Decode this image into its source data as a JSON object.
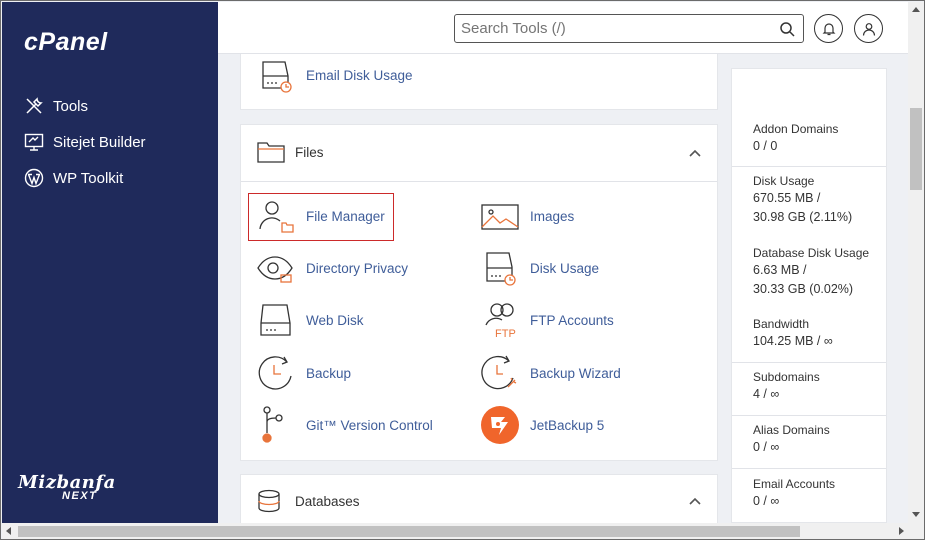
{
  "brand": {
    "logo": "cPanel",
    "footer_line1": "Mizbanfa",
    "footer_line2": "NEXT"
  },
  "sidebar": {
    "items": [
      {
        "label": "Tools",
        "icon": "tools-icon"
      },
      {
        "label": "Sitejet Builder",
        "icon": "sitejet-icon"
      },
      {
        "label": "WP Toolkit",
        "icon": "wordpress-icon"
      }
    ]
  },
  "header": {
    "search_placeholder": "Search Tools (/)",
    "notifications_icon": "bell-icon",
    "user_icon": "user-icon"
  },
  "top_panel": {
    "tool": "Email Disk Usage"
  },
  "files": {
    "title": "Files",
    "tools": [
      {
        "label": "File Manager",
        "icon": "file-manager-icon",
        "highlighted": true
      },
      {
        "label": "Images",
        "icon": "images-icon"
      },
      {
        "label": "Directory Privacy",
        "icon": "directory-privacy-icon"
      },
      {
        "label": "Disk Usage",
        "icon": "disk-usage-icon"
      },
      {
        "label": "Web Disk",
        "icon": "web-disk-icon"
      },
      {
        "label": "FTP Accounts",
        "icon": "ftp-accounts-icon"
      },
      {
        "label": "Backup",
        "icon": "backup-icon"
      },
      {
        "label": "Backup Wizard",
        "icon": "backup-wizard-icon"
      },
      {
        "label": "Git™ Version Control",
        "icon": "git-icon"
      },
      {
        "label": "JetBackup 5",
        "icon": "jetbackup-icon"
      }
    ]
  },
  "databases": {
    "title": "Databases"
  },
  "stats": [
    {
      "label": "Addon Domains",
      "value": "0 / 0"
    },
    {
      "label": "Disk Usage",
      "value1": "670.55 MB /",
      "value2": "30.98 GB  (2.11%)"
    },
    {
      "label": "Database Disk Usage",
      "value1": "6.63 MB /",
      "value2": "30.33 GB  (0.02%)"
    },
    {
      "label": "Bandwidth",
      "value": "104.25 MB / ∞"
    },
    {
      "label": "Subdomains",
      "value": "4 / ∞"
    },
    {
      "label": "Alias Domains",
      "value": "0 / ∞"
    },
    {
      "label": "Email Accounts",
      "value": "0 / ∞"
    }
  ],
  "colors": {
    "sidebar_bg": "#1f2a5b",
    "link": "#3f5d99",
    "accent": "#e8743b",
    "highlight_border": "#cc2a2a"
  }
}
